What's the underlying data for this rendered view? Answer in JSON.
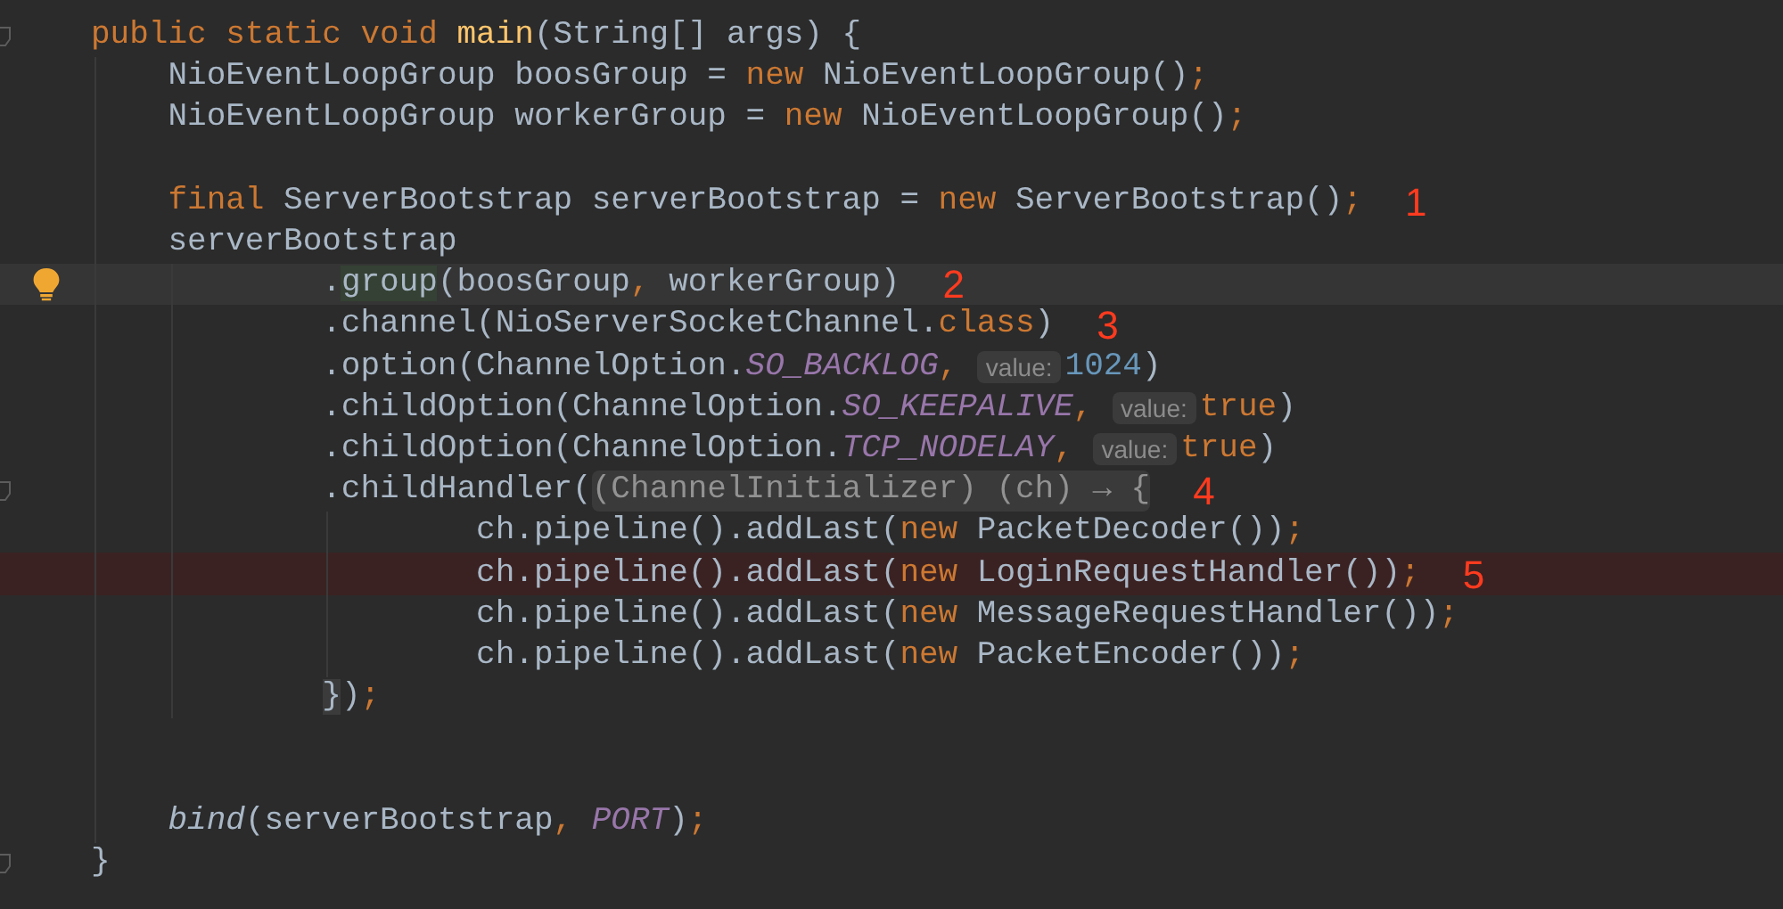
{
  "editor": {
    "lines": [
      {
        "caret_line": false,
        "error_line": false,
        "foldable": true,
        "tokens": [
          {
            "t": "public static void ",
            "kind": "keyword"
          },
          {
            "t": "main",
            "kind": "method"
          },
          {
            "t": "(String[] args) {",
            "kind": "plain"
          }
        ]
      },
      {
        "caret_line": false,
        "error_line": false,
        "foldable": false,
        "tokens": [
          {
            "t": "    NioEventLoopGroup boosGroup = ",
            "kind": "plain"
          },
          {
            "t": "new",
            "kind": "keyword"
          },
          {
            "t": " NioEventLoopGroup()",
            "kind": "plain"
          },
          {
            "t": ";",
            "kind": "keyword"
          }
        ]
      },
      {
        "caret_line": false,
        "error_line": false,
        "foldable": false,
        "tokens": [
          {
            "t": "    NioEventLoopGroup workerGroup = ",
            "kind": "plain"
          },
          {
            "t": "new",
            "kind": "keyword"
          },
          {
            "t": " NioEventLoopGroup()",
            "kind": "plain"
          },
          {
            "t": ";",
            "kind": "keyword"
          }
        ]
      },
      {
        "caret_line": false,
        "error_line": false,
        "foldable": false
      },
      {
        "caret_line": false,
        "error_line": false,
        "foldable": false,
        "annotation": "1",
        "tokens": [
          {
            "t": "    final",
            "kind": "keyword"
          },
          {
            "t": " ServerBootstrap serverBootstrap = ",
            "kind": "plain"
          },
          {
            "t": "new",
            "kind": "keyword"
          },
          {
            "t": " ServerBootstrap()",
            "kind": "plain"
          },
          {
            "t": ";",
            "kind": "keyword"
          }
        ]
      },
      {
        "caret_line": false,
        "error_line": false,
        "foldable": false,
        "tokens": [
          {
            "t": "    serverBootstrap",
            "kind": "plain"
          }
        ]
      },
      {
        "caret_line": true,
        "error_line": false,
        "foldable": false,
        "annotation": "2",
        "tokens": [
          {
            "t": "            .",
            "kind": "plain"
          },
          {
            "t": "group",
            "kind": "match"
          },
          {
            "t": "(boosGroup",
            "kind": "plain"
          },
          {
            "t": ",",
            "kind": "keyword"
          },
          {
            "t": " workerGroup)",
            "kind": "plain"
          }
        ]
      },
      {
        "caret_line": false,
        "error_line": false,
        "foldable": false,
        "annotation": "3",
        "tokens": [
          {
            "t": "            .channel(NioServerSocketChannel.",
            "kind": "plain"
          },
          {
            "t": "class",
            "kind": "keyword"
          },
          {
            "t": ")",
            "kind": "plain"
          }
        ]
      },
      {
        "caret_line": false,
        "error_line": false,
        "foldable": false,
        "tokens": [
          {
            "t": "            .option(ChannelOption.",
            "kind": "plain"
          },
          {
            "t": "SO_BACKLOG",
            "kind": "constant"
          },
          {
            "t": ", ",
            "kind": "keyword"
          },
          {
            "t": "value:",
            "kind": "hint"
          },
          {
            "t": "1024",
            "kind": "number"
          },
          {
            "t": ")",
            "kind": "plain"
          }
        ]
      },
      {
        "caret_line": false,
        "error_line": false,
        "foldable": false,
        "tokens": [
          {
            "t": "            .childOption(ChannelOption.",
            "kind": "plain"
          },
          {
            "t": "SO_KEEPALIVE",
            "kind": "constant"
          },
          {
            "t": ", ",
            "kind": "keyword"
          },
          {
            "t": "value:",
            "kind": "hint"
          },
          {
            "t": "true",
            "kind": "keyword"
          },
          {
            "t": ")",
            "kind": "plain"
          }
        ]
      },
      {
        "caret_line": false,
        "error_line": false,
        "foldable": false,
        "tokens": [
          {
            "t": "            .childOption(ChannelOption.",
            "kind": "plain"
          },
          {
            "t": "TCP_NODELAY",
            "kind": "constant"
          },
          {
            "t": ", ",
            "kind": "keyword"
          },
          {
            "t": "value:",
            "kind": "hint"
          },
          {
            "t": "true",
            "kind": "keyword"
          },
          {
            "t": ")",
            "kind": "plain"
          }
        ]
      },
      {
        "caret_line": false,
        "error_line": false,
        "foldable": true,
        "annotation": "4",
        "tokens": [
          {
            "t": "            .childHandler(",
            "kind": "plain"
          },
          {
            "t": "(ChannelInitializer) (ch) → {",
            "kind": "fold"
          }
        ]
      },
      {
        "caret_line": false,
        "error_line": false,
        "foldable": false,
        "tokens": [
          {
            "t": "                    ch.pipeline().addLast(",
            "kind": "plain"
          },
          {
            "t": "new",
            "kind": "keyword"
          },
          {
            "t": " PacketDecoder())",
            "kind": "plain"
          },
          {
            "t": ";",
            "kind": "keyword"
          }
        ]
      },
      {
        "caret_line": false,
        "error_line": true,
        "foldable": false,
        "annotation": "5",
        "tokens": [
          {
            "t": "                    ch.pipeline().addLast(",
            "kind": "plain"
          },
          {
            "t": "new",
            "kind": "keyword"
          },
          {
            "t": " LoginRequestHandler())",
            "kind": "plain"
          },
          {
            "t": ";",
            "kind": "keyword"
          }
        ]
      },
      {
        "caret_line": false,
        "error_line": false,
        "foldable": false,
        "tokens": [
          {
            "t": "                    ch.pipeline().addLast(",
            "kind": "plain"
          },
          {
            "t": "new",
            "kind": "keyword"
          },
          {
            "t": " MessageRequestHandler())",
            "kind": "plain"
          },
          {
            "t": ";",
            "kind": "keyword"
          }
        ]
      },
      {
        "caret_line": false,
        "error_line": false,
        "foldable": false,
        "tokens": [
          {
            "t": "                    ch.pipeline().addLast(",
            "kind": "plain"
          },
          {
            "t": "new",
            "kind": "keyword"
          },
          {
            "t": " PacketEncoder())",
            "kind": "plain"
          },
          {
            "t": ";",
            "kind": "keyword"
          }
        ]
      },
      {
        "caret_line": false,
        "error_line": false,
        "foldable": false,
        "tokens": [
          {
            "t": "            }",
            "kind": "brace"
          },
          {
            "t": ")",
            "kind": "plain"
          },
          {
            "t": ";",
            "kind": "keyword"
          }
        ]
      },
      {
        "caret_line": false,
        "error_line": false,
        "foldable": false
      },
      {
        "caret_line": false,
        "error_line": false,
        "foldable": false
      },
      {
        "caret_line": false,
        "error_line": false,
        "foldable": false,
        "tokens": [
          {
            "t": "    bind",
            "kind": "call"
          },
          {
            "t": "(serverBootstrap",
            "kind": "plain"
          },
          {
            "t": ", ",
            "kind": "keyword"
          },
          {
            "t": "PORT",
            "kind": "constant"
          },
          {
            "t": ")",
            "kind": "plain"
          },
          {
            "t": ";",
            "kind": "keyword"
          }
        ]
      },
      {
        "caret_line": false,
        "error_line": false,
        "foldable": true,
        "tokens": [
          {
            "t": "}",
            "kind": "plain"
          }
        ]
      }
    ]
  }
}
